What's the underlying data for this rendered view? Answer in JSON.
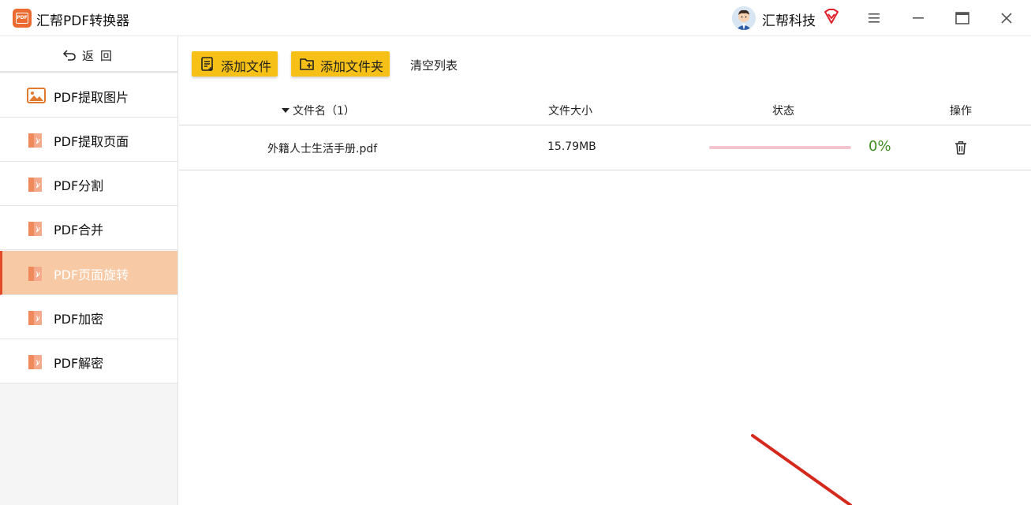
{
  "app": {
    "title": "汇帮PDF转换器",
    "user_name": "汇帮科技"
  },
  "sidebar": {
    "back_label": "返回",
    "items": [
      {
        "label": "PDF提取图片",
        "icon": "image-icon"
      },
      {
        "label": "PDF提取页面",
        "icon": "pdf-file-icon"
      },
      {
        "label": "PDF分割",
        "icon": "pdf-file-icon"
      },
      {
        "label": "PDF合并",
        "icon": "pdf-file-icon"
      },
      {
        "label": "PDF页面旋转",
        "icon": "pdf-file-icon",
        "active": true
      },
      {
        "label": "PDF加密",
        "icon": "pdf-file-icon"
      },
      {
        "label": "PDF解密",
        "icon": "pdf-file-icon"
      }
    ]
  },
  "toolbar": {
    "add_file_label": "添加文件",
    "add_folder_label": "添加文件夹",
    "clear_list_label": "清空列表"
  },
  "table": {
    "headers": {
      "name": "文件名（1）",
      "size": "文件大小",
      "status": "状态",
      "ops": "操作"
    },
    "rows": [
      {
        "name": "外籍人士生活手册.pdf",
        "size": "15.79MB",
        "progress_percent": 0,
        "progress_label": "0%"
      }
    ]
  },
  "colors": {
    "accent_yellow": "#f6c016",
    "active_item_bg": "#f7c9a5",
    "active_item_border": "#e24b2a",
    "progress_track": "#f4c4cf",
    "progress_text": "#3c8d1e",
    "brand_orange": "#ea6a2f",
    "annotation_arrow": "#d42a1e"
  }
}
